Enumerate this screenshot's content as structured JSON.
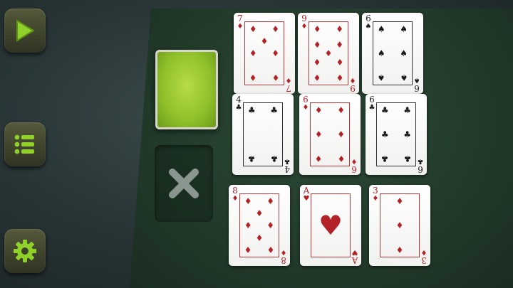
{
  "sidebar": {
    "buttons": [
      {
        "id": "play",
        "icon": "play-icon"
      },
      {
        "id": "list",
        "icon": "list-icon"
      },
      {
        "id": "settings",
        "icon": "gear-icon"
      }
    ]
  },
  "colors": {
    "red_suit": "#b22227",
    "black_suit": "#1b1b1b",
    "accent_green": "#8fd12a",
    "felt": "#223a2a"
  },
  "deck": {
    "back_icon": "card-back"
  },
  "discard": {
    "icon": "close-icon"
  },
  "grid": [
    {
      "rank": "7",
      "suit": "♦",
      "color": "red"
    },
    {
      "rank": "9",
      "suit": "♦",
      "color": "red"
    },
    {
      "rank": "6",
      "suit": "♠",
      "color": "black"
    },
    {
      "rank": "4",
      "suit": "♣",
      "color": "black"
    },
    {
      "rank": "6",
      "suit": "♦",
      "color": "red"
    },
    {
      "rank": "6",
      "suit": "♣",
      "color": "black"
    },
    {
      "rank": "8",
      "suit": "♦",
      "color": "red"
    },
    {
      "rank": "A",
      "suit": "♥",
      "color": "red"
    },
    {
      "rank": "3",
      "suit": "♦",
      "color": "red"
    }
  ]
}
